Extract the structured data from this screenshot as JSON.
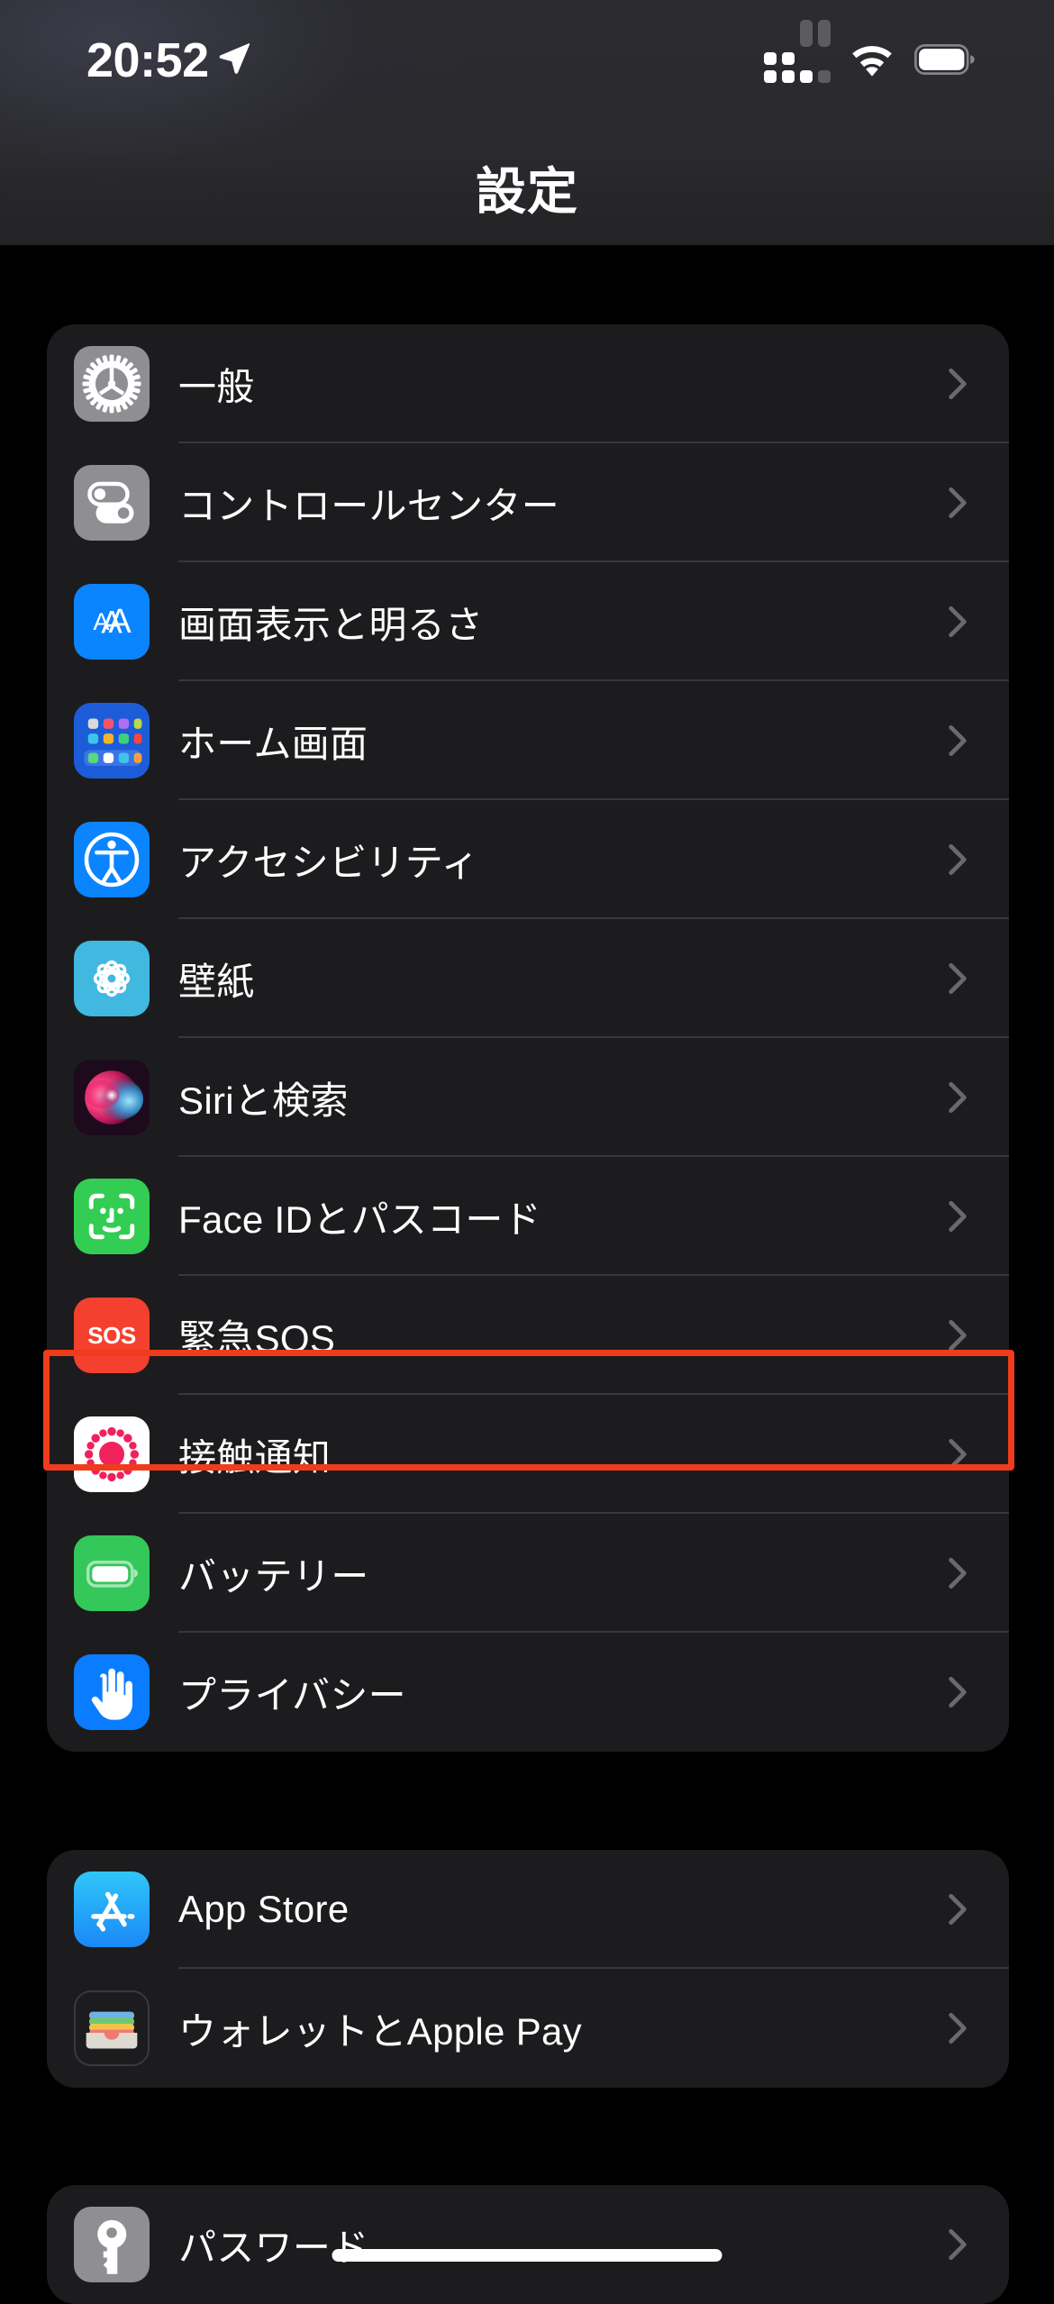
{
  "status_bar": {
    "time": "20:52",
    "location_icon": "location-arrow-icon",
    "cellular_icon": "cellular-signal-icon",
    "wifi_icon": "wifi-icon",
    "battery_icon": "battery-full-icon"
  },
  "nav": {
    "title": "設定"
  },
  "highlight": {
    "target_label": "接触通知",
    "color": "#f03b1c"
  },
  "groups": [
    {
      "id": "group-1",
      "rows": [
        {
          "label": "一般",
          "icon": "gear-icon",
          "icon_color": "#8e8e93"
        },
        {
          "label": "コントロールセンター",
          "icon": "toggles-icon",
          "icon_color": "#8e8e93"
        },
        {
          "label": "画面表示と明るさ",
          "icon": "display-aa-icon",
          "icon_color": "#0a84ff"
        },
        {
          "label": "ホーム画面",
          "icon": "home-screen-icon",
          "icon_color": "#1c5cd8"
        },
        {
          "label": "アクセシビリティ",
          "icon": "accessibility-icon",
          "icon_color": "#0a84ff"
        },
        {
          "label": "壁紙",
          "icon": "wallpaper-icon",
          "icon_color": "#41b8e0"
        },
        {
          "label": "Siriと検索",
          "icon": "siri-icon",
          "icon_color": "#d63a6a"
        },
        {
          "label": "Face IDとパスコード",
          "icon": "face-id-icon",
          "icon_color": "#32cd52"
        },
        {
          "label": "緊急SOS",
          "icon": "sos-icon",
          "icon_color": "#f4402e"
        },
        {
          "label": "接触通知",
          "icon": "exposure-notification-icon",
          "icon_color": "#ffffff"
        },
        {
          "label": "バッテリー",
          "icon": "battery-icon",
          "icon_color": "#34c759"
        },
        {
          "label": "プライバシー",
          "icon": "privacy-hand-icon",
          "icon_color": "#0a7cff"
        }
      ]
    },
    {
      "id": "group-2",
      "rows": [
        {
          "label": "App Store",
          "icon": "app-store-icon",
          "icon_color": "#1aa2f5"
        },
        {
          "label": "ウォレットとApple Pay",
          "icon": "wallet-icon",
          "icon_color": "#1c1c1e"
        }
      ]
    },
    {
      "id": "group-3",
      "rows": [
        {
          "label": "パスワード",
          "icon": "passwords-key-icon",
          "icon_color": "#8e8e93"
        }
      ]
    }
  ],
  "chevron_icon": "chevron-right-icon"
}
